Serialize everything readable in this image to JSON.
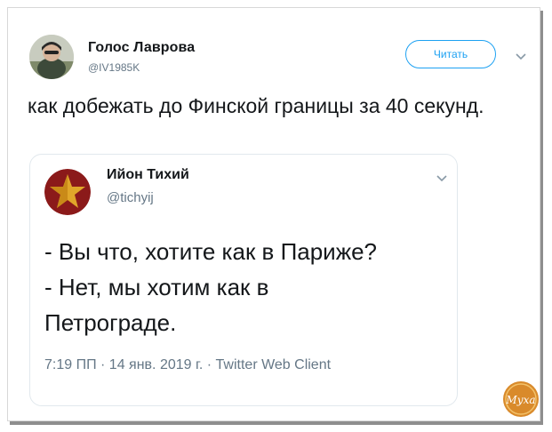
{
  "tweet": {
    "author_name": "Голос Лаврова",
    "author_handle": "@IV1985K",
    "follow_label": "Читать",
    "text": "как добежать до Финской границы за 40 секунд.",
    "menu_icon": "chevron-down-icon"
  },
  "quoted": {
    "author_name": "Ийон Тихий",
    "author_handle": "@tichyij",
    "lines": [
      "- Вы что, хотите как в Париже?",
      "- Нет, мы хотим как в",
      "Петрограде."
    ],
    "meta": "7:19 ПП · 14 янв. 2019 г. · Twitter Web Client",
    "menu_icon": "chevron-down-icon"
  },
  "watermark": {
    "text": "Муха"
  },
  "colors": {
    "accent": "#1da1f2",
    "muted": "#657786",
    "border": "#e1e8ed",
    "star_bg": "#8b1a1a",
    "star": "#e0a62a"
  }
}
